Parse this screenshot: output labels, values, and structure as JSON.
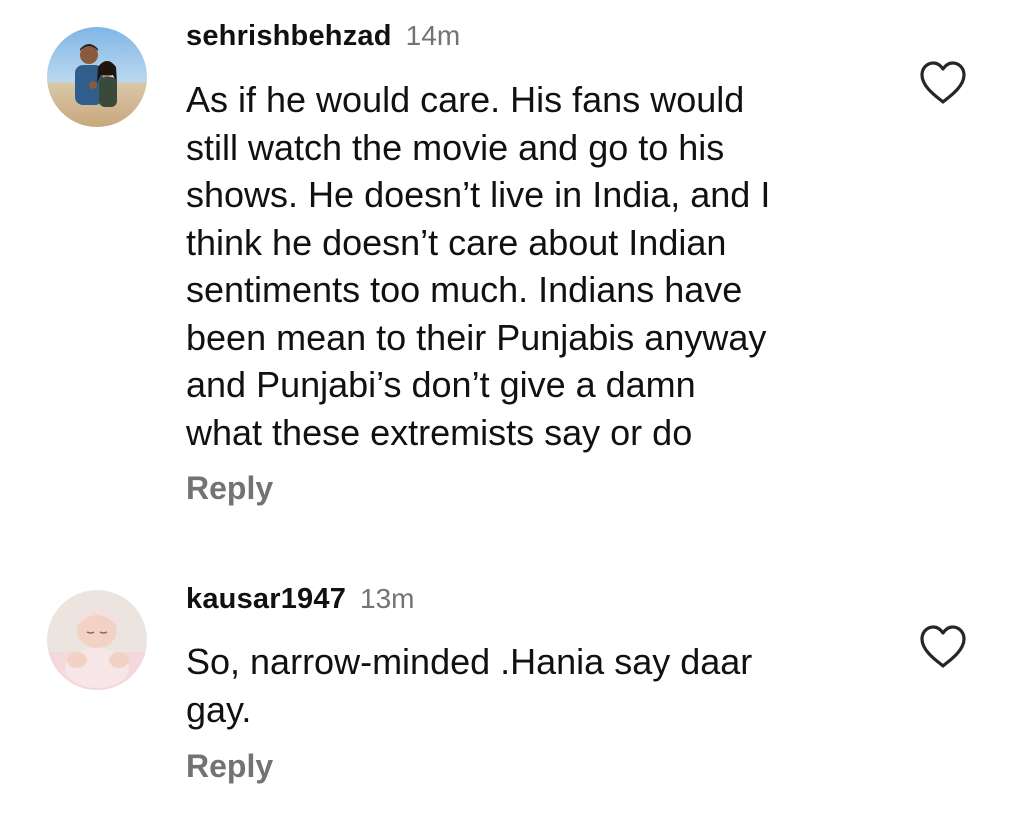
{
  "comments": [
    {
      "username": "sehrishbehzad",
      "time": "14m",
      "text": "As if he would care. His fans would\nstill watch the movie and go to his\nshows. He doesn’t live in India, and I\nthink he doesn’t care about Indian\nsentiments too much. Indians have\nbeen mean to their Punjabis anyway\nand Punjabi’s don’t give a damn\nwhat these extremists say or do",
      "reply_label": "Reply",
      "like_icon": "heart-outline-icon"
    },
    {
      "username": "kausar1947",
      "time": "13m",
      "text": "So, narrow-minded .Hania say daar\ngay.",
      "reply_label": "Reply",
      "like_icon": "heart-outline-icon"
    }
  ],
  "colors": {
    "text": "#111111",
    "muted": "#737373",
    "background": "#ffffff"
  }
}
